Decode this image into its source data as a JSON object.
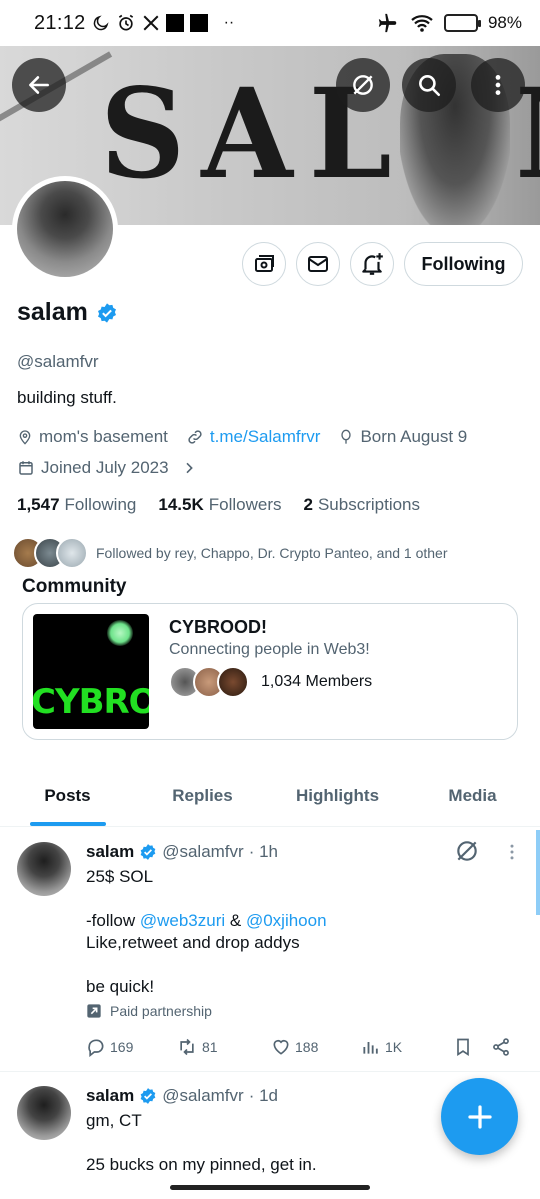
{
  "status_bar": {
    "time": "21:12",
    "battery": "98%",
    "battery_level": 0.98,
    "icons": [
      "moon-icon",
      "alarm-icon",
      "x-logo-icon",
      "airplane-icon",
      "wifi-icon",
      "battery-icon"
    ]
  },
  "banner": {
    "text": "SALAM"
  },
  "header_buttons": [
    "back-arrow-icon",
    "grok-icon",
    "search-icon",
    "more-vertical-icon"
  ],
  "profile": {
    "display_name": "salam",
    "handle": "@salamfvr",
    "bio": "building stuff.",
    "location": "mom's basement",
    "link": "t.me/Salamfrvr",
    "birthday": "Born August 9",
    "joined": "Joined July 2023",
    "follow_button": "Following",
    "stats": {
      "following_count": "1,547",
      "following_label": "Following",
      "followers_count": "14.5K",
      "followers_label": "Followers",
      "subscriptions_count": "2",
      "subscriptions_label": "Subscriptions"
    },
    "followed_by": "Followed by rey, Chappo, Dr. Crypto Panteo, and 1 other"
  },
  "community": {
    "section_title": "Community",
    "name": "CYBROOD!",
    "description": "Connecting people in Web3!",
    "members": "1,034 Members",
    "image_text": "CYBRO"
  },
  "tabs": [
    {
      "label": "Posts",
      "active": true
    },
    {
      "label": "Replies",
      "active": false
    },
    {
      "label": "Highlights",
      "active": false
    },
    {
      "label": "Media",
      "active": false
    }
  ],
  "posts": [
    {
      "name": "salam",
      "handle": "@salamfvr",
      "time": "· 1h",
      "line1": "25$ SOL",
      "line2_pre": "-follow ",
      "mention1": "@web3zuri",
      "line2_mid": " & ",
      "mention2": "@0xjihoon",
      "line3": "Like,retweet and drop addys",
      "line4": "be quick!",
      "paid": "Paid partnership",
      "replies": "169",
      "reposts": "81",
      "likes": "188",
      "views": "1K"
    },
    {
      "name": "salam",
      "handle": "@salamfvr",
      "time": "· 1d",
      "line1": "gm, CT",
      "line2": "25 bucks on my pinned, get in."
    }
  ],
  "colors": {
    "accent": "#1d9bf0",
    "text": "#0f1419",
    "muted": "#536471",
    "border": "#cfd9de"
  }
}
